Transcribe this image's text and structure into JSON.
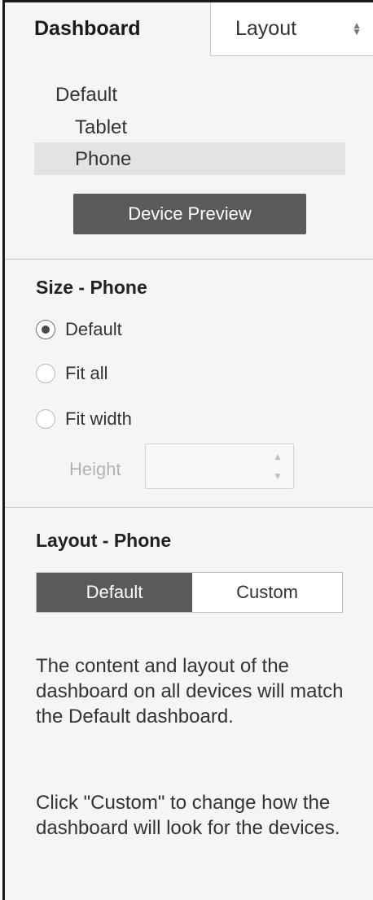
{
  "tabs": {
    "dashboard": "Dashboard",
    "layout": "Layout"
  },
  "devices": {
    "default": "Default",
    "tablet": "Tablet",
    "phone": "Phone",
    "selected": "Phone",
    "preview_button": "Device Preview"
  },
  "size": {
    "title": "Size - Phone",
    "options": [
      "Default",
      "Fit all",
      "Fit width"
    ],
    "selected": "Default",
    "height_label": "Height",
    "height_value": ""
  },
  "layout": {
    "title": "Layout - Phone",
    "segments": [
      "Default",
      "Custom"
    ],
    "selected": "Default",
    "description_1": "The content and layout of the dashboard on all devices will match the Default dashboard.",
    "description_2": "Click \"Custom\" to change how the dashboard will look for the devices."
  },
  "colors": {
    "panel_bg": "#f5f5f5",
    "selected_row": "#e3e3e3",
    "button_dark": "#5a5a5a"
  },
  "icons": {
    "tab_dropdown": "up-down-arrow-icon",
    "height_stepper": "stepper-icon"
  }
}
